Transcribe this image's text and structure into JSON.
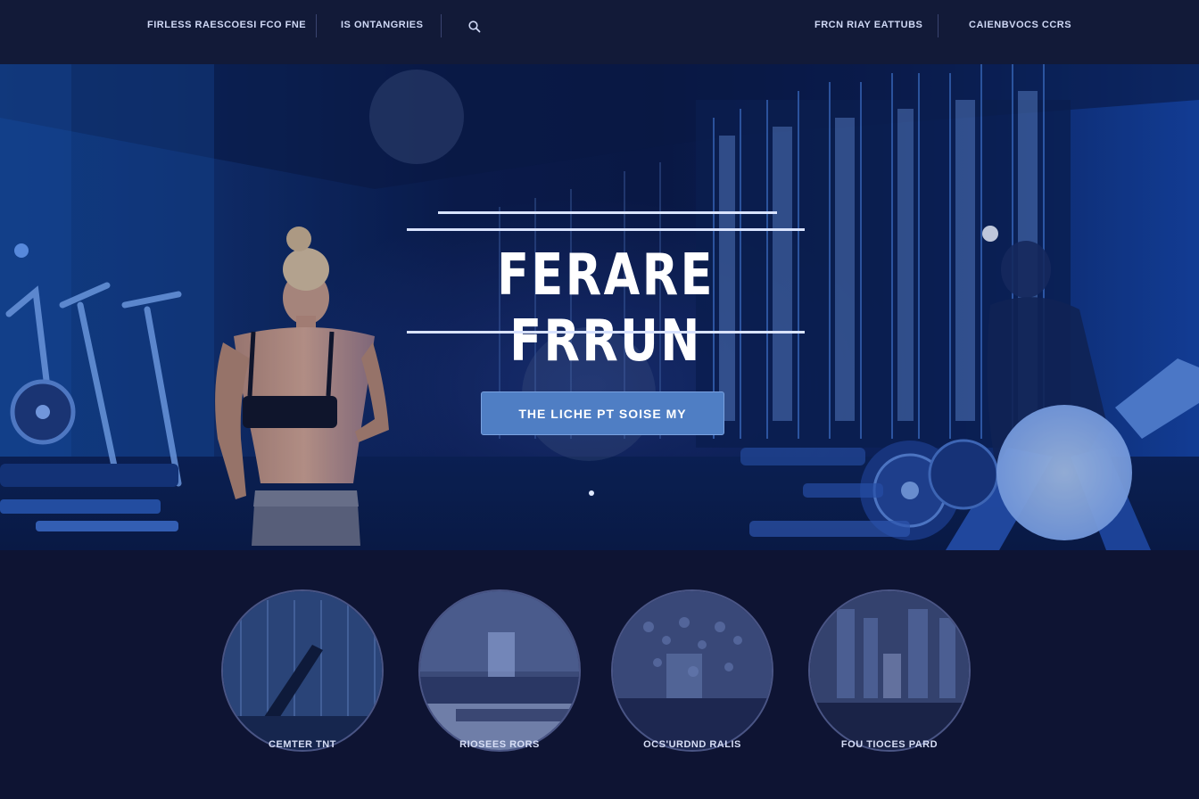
{
  "nav": {
    "link1": "FIRLESS RAESCOESI FCO FNE",
    "link2": "IS ONTANGRIES",
    "link3": "FRCN RIAY EATTUBS",
    "link4": "CAIENBVOCS CCRS"
  },
  "hero": {
    "title": "FERARE FRRUN",
    "cta_label": "THE LICHE PT SOISE MY"
  },
  "cards": [
    {
      "label": "CEMTER TNT"
    },
    {
      "label": "RIOSEES RORS"
    },
    {
      "label": "OCS'URDND RALIS"
    },
    {
      "label": "FOU TIOCES PARD"
    }
  ],
  "colors": {
    "nav_bg": "#121a38",
    "page_bg": "#0e1433",
    "accent_button": "#4f7ec4",
    "hero_blue": "#1546a8"
  }
}
